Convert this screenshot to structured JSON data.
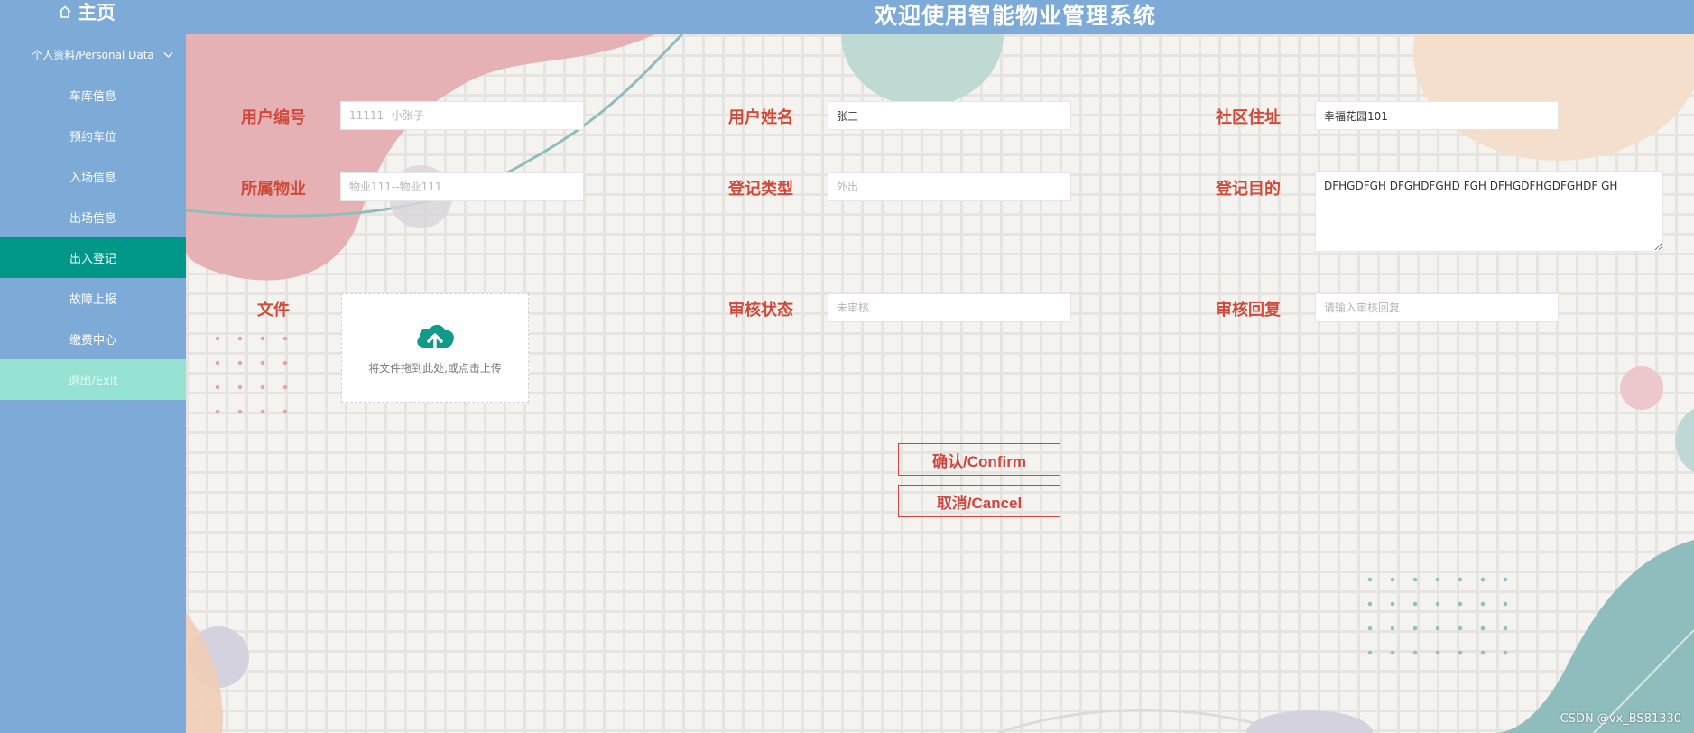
{
  "header": {
    "home_label": "主页",
    "title": "欢迎使用智能物业管理系统"
  },
  "sidebar": {
    "group_label": "个人资料/Personal Data",
    "items": [
      {
        "label": "车库信息"
      },
      {
        "label": "预约车位"
      },
      {
        "label": "入场信息"
      },
      {
        "label": "出场信息"
      },
      {
        "label": "出入登记"
      },
      {
        "label": "故障上报"
      },
      {
        "label": "缴费中心"
      },
      {
        "label": "退出/Exit"
      }
    ],
    "active_index": 4
  },
  "form": {
    "user_no": {
      "label": "用户编号",
      "value": "",
      "placeholder": "11111--小张子"
    },
    "user_name": {
      "label": "用户姓名",
      "value": "张三",
      "placeholder": ""
    },
    "community_address": {
      "label": "社区住址",
      "value": "幸福花园101",
      "placeholder": ""
    },
    "property": {
      "label": "所属物业",
      "value": "",
      "placeholder": "物业111--物业111"
    },
    "register_type": {
      "label": "登记类型",
      "value": "",
      "placeholder": "外出"
    },
    "register_purpose": {
      "label": "登记目的",
      "value": "DFHGDFGH DFGHDFGHD FGH DFHGDFHGDFGHDF GH",
      "placeholder": ""
    },
    "file": {
      "label": "文件",
      "upload_text": "将文件拖到此处,或点击上传"
    },
    "review_status": {
      "label": "审核状态",
      "value": "",
      "placeholder": "未审核"
    },
    "review_reply": {
      "label": "审核回复",
      "value": "",
      "placeholder": "请输入审核回复"
    }
  },
  "buttons": {
    "confirm": "确认/Confirm",
    "cancel": "取消/Cancel"
  },
  "watermark": "CSDN @vx_BS81330",
  "colors": {
    "header_bg": "#7eaad8",
    "active_item": "#009688",
    "exit_item": "#96e3d3",
    "label": "#cf4a3a",
    "button": "#d0453f"
  }
}
